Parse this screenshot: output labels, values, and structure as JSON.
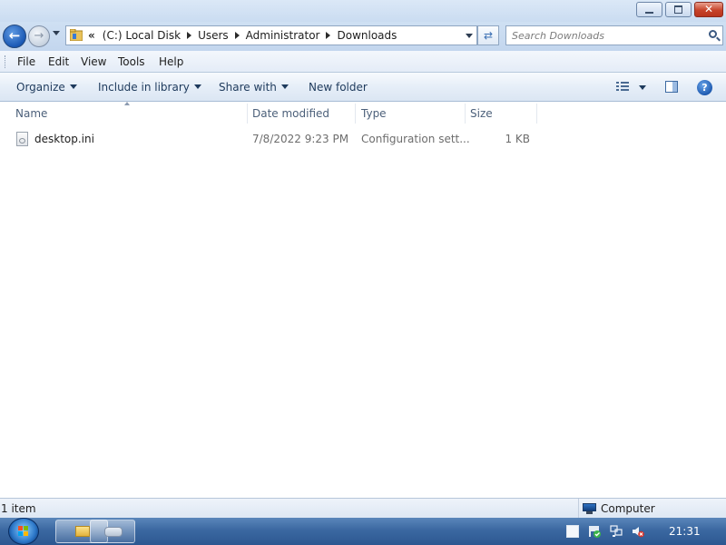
{
  "window": {
    "controls": {
      "minimize": "minimize",
      "maximize": "restore",
      "close": "✕"
    }
  },
  "nav": {
    "back_icon": "back-arrow-icon",
    "forward_icon": "forward-arrow-icon",
    "breadcrumb": {
      "overflow": "«",
      "items": [
        "(C:) Local Disk",
        "Users",
        "Administrator",
        "Downloads"
      ]
    },
    "search_placeholder": "Search Downloads"
  },
  "menubar": {
    "items": [
      "File",
      "Edit",
      "View",
      "Tools",
      "Help"
    ]
  },
  "commandbar": {
    "organize": "Organize",
    "include_in_library": "Include in library",
    "share_with": "Share with",
    "new_folder": "New folder"
  },
  "filelist": {
    "columns": [
      "Name",
      "Date modified",
      "Type",
      "Size"
    ],
    "rows": [
      {
        "name": "desktop.ini",
        "date_modified": "7/8/2022 9:23 PM",
        "type": "Configuration sett...",
        "size": "1 KB"
      }
    ]
  },
  "statusbar": {
    "item_count": "1 item",
    "location": "Computer"
  },
  "taskbar": {
    "clock": "21:31"
  },
  "colors": {
    "accent": "#1b59b5",
    "taskbar": "#3b68a1",
    "command_text": "#1e3a5c"
  }
}
